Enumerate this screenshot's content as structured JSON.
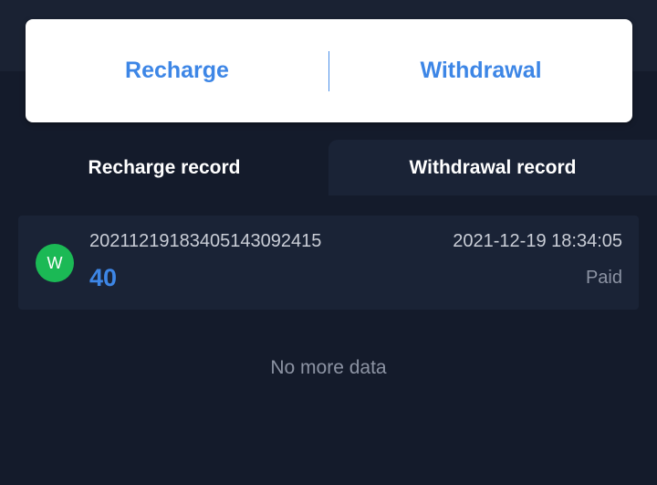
{
  "actions": {
    "recharge_label": "Recharge",
    "withdrawal_label": "Withdrawal"
  },
  "tabs": [
    {
      "label": "Recharge record",
      "active": false
    },
    {
      "label": "Withdrawal record",
      "active": true
    }
  ],
  "records": [
    {
      "avatar_letter": "W",
      "order_id": "20211219183405143092415",
      "amount": "40",
      "timestamp": "2021-12-19 18:34:05",
      "status": "Paid"
    }
  ],
  "footer": {
    "no_more_text": "No more data"
  },
  "colors": {
    "accent": "#3d86e6",
    "avatar": "#1bb955",
    "background": "#141b2b",
    "card": "#1a2336"
  }
}
